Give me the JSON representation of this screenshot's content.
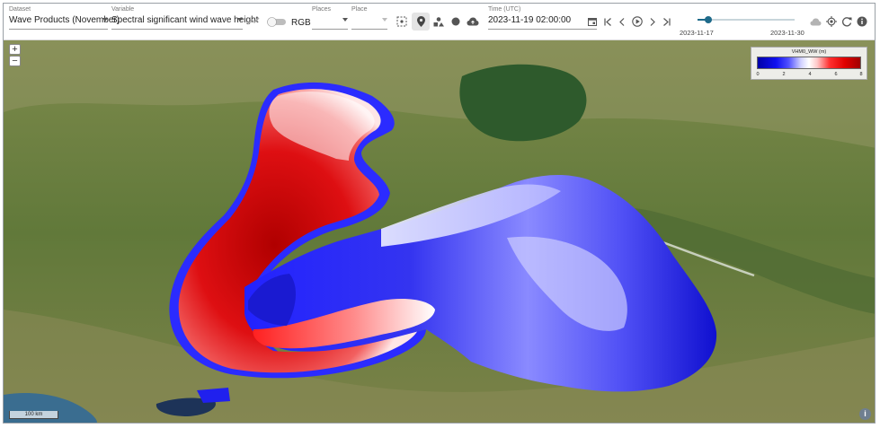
{
  "toolbar": {
    "dataset": {
      "label": "Dataset",
      "value": "Wave Products (November)"
    },
    "variable": {
      "label": "Variable",
      "value": "Spectral significant wind wave height"
    },
    "rgb_label": "RGB",
    "places1": {
      "label": "Places",
      "value": ""
    },
    "places2": {
      "label": "Place",
      "value": ""
    },
    "time": {
      "label": "Time (UTC)",
      "value": "2023-11-19 02:00:00"
    },
    "slider": {
      "start_label": "2023-11-17",
      "end_label": "2023-11-30",
      "position": 0.12
    }
  },
  "map": {
    "zoom_in": "+",
    "zoom_out": "−",
    "legend": {
      "title": "VHM0_WW (m)",
      "ticks": [
        "0",
        "2",
        "4",
        "6",
        "8"
      ]
    },
    "scale_bar": "100 km",
    "info": "i"
  },
  "colors": {
    "accent": "#1e6a8a",
    "wave_high": "#d40000",
    "wave_low": "#1a1aee",
    "land": "#6a7d3c"
  }
}
